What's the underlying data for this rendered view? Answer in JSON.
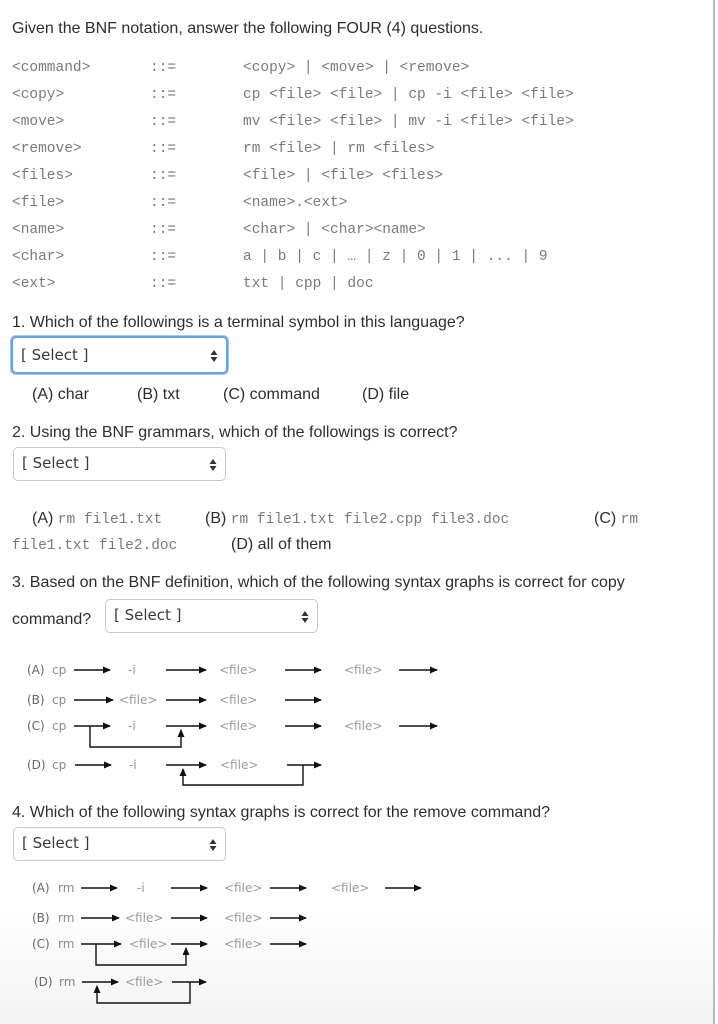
{
  "intro": "Given the BNF notation, answer the following FOUR (4) questions.",
  "bnf": [
    {
      "lhs": "<command>",
      "op": "::=",
      "rhs": "<copy> | <move> | <remove>"
    },
    {
      "lhs": "<copy>",
      "op": "::=",
      "rhs": "cp <file> <file> | cp -i <file> <file>"
    },
    {
      "lhs": "<move>",
      "op": "::=",
      "rhs": "mv <file> <file> | mv -i <file> <file>"
    },
    {
      "lhs": "<remove>",
      "op": "::=",
      "rhs": "rm <file> | rm <files>"
    },
    {
      "lhs": "<files>",
      "op": "::=",
      "rhs": "<file> | <file> <files>"
    },
    {
      "lhs": "<file>",
      "op": "::=",
      "rhs": "<name>.<ext>"
    },
    {
      "lhs": "<name>",
      "op": "::=",
      "rhs": "<char> | <char><name>"
    },
    {
      "lhs": "<char>",
      "op": "::=",
      "rhs": "a | b | c | … | z | 0 | 1 | ... | 9"
    },
    {
      "lhs": "<ext>",
      "op": "::=",
      "rhs": "txt | cpp | doc"
    }
  ],
  "questions": [
    {
      "text": "1. Which of the followings is a terminal symbol in this language?",
      "select": "[ Select ]",
      "options": [
        "(A) char",
        "(B) txt",
        "(C) command",
        "(D) file"
      ]
    },
    {
      "text": "2. Using the BNF grammars, which of the followings is correct?",
      "select": "[ Select ]",
      "options": [
        {
          "label": "(A)",
          "code": "rm file1.txt"
        },
        {
          "label": "(B)",
          "code": "rm file1.txt file2.cpp file3.doc"
        },
        {
          "label": "(C)",
          "code": "rm",
          "code2": "file1.txt file2.doc"
        },
        {
          "label": "(D)",
          "text": "all of them"
        }
      ]
    },
    {
      "text": "3. Based on the BNF definition, which of the following syntax graphs is correct for copy",
      "text2": "command?",
      "select": "[ Select ]",
      "graphs": [
        {
          "label": "(A)",
          "cmd": "cp",
          "tokens": [
            "-i",
            "<file>",
            "<file>"
          ]
        },
        {
          "label": "(B)",
          "cmd": "cp",
          "tokens": [
            "<file>",
            "<file>"
          ]
        },
        {
          "label": "(C)",
          "cmd": "cp",
          "tokens": [
            "-i",
            "<file>",
            "<file>"
          ]
        },
        {
          "label": "(D)",
          "cmd": "cp",
          "tokens": [
            "-i",
            "<file>"
          ]
        }
      ]
    },
    {
      "text": "4. Which of the following syntax graphs is correct for the remove command?",
      "select": "[ Select ]",
      "graphs": [
        {
          "label": "(A)",
          "cmd": "rm",
          "tokens": [
            "-i",
            "<file>",
            "<file>"
          ]
        },
        {
          "label": "(B)",
          "cmd": "rm",
          "tokens": [
            "<file>",
            "<file>"
          ]
        },
        {
          "label": "(C)",
          "cmd": "rm",
          "tokens": [
            "<file>",
            "<file>"
          ]
        },
        {
          "label": "(D)",
          "cmd": "rm",
          "tokens": [
            "<file>"
          ]
        }
      ]
    }
  ]
}
